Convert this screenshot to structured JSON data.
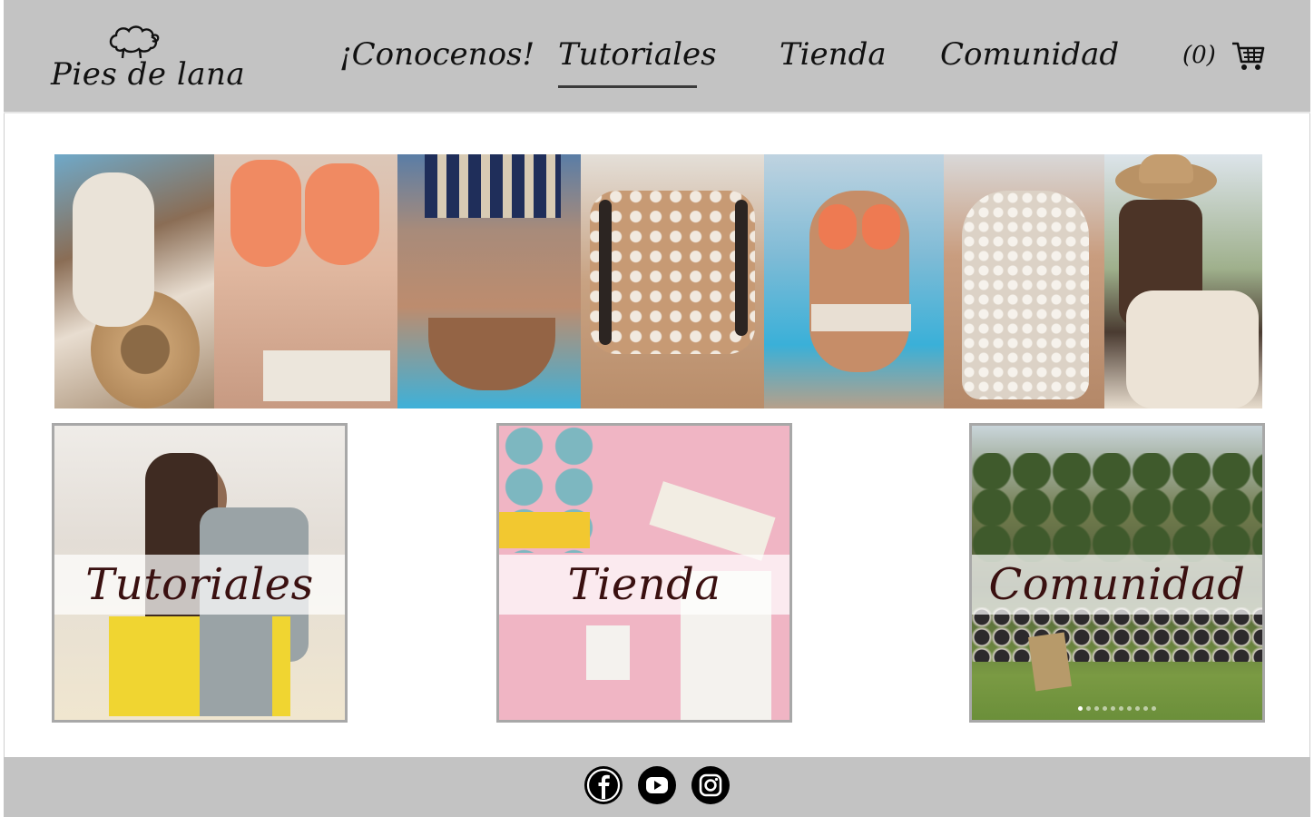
{
  "brand": {
    "name": "Pies de lana"
  },
  "nav": {
    "items": [
      {
        "label": "¡Conocenos!"
      },
      {
        "label": "Tutoriales"
      },
      {
        "label": "Tienda"
      },
      {
        "label": "Comunidad"
      }
    ],
    "active": "Tutoriales"
  },
  "cart": {
    "count": "(0)",
    "icon": "shopping-cart-icon"
  },
  "gallery": {
    "photos": [
      {
        "icon": "crochet-swimsuit-hat-photo"
      },
      {
        "icon": "coral-crochet-bikini-photo"
      },
      {
        "icon": "striped-crochet-bikini-photo"
      },
      {
        "icon": "crochet-halter-top-photo"
      },
      {
        "icon": "coral-bikini-pool-photo"
      },
      {
        "icon": "white-crochet-top-photo"
      },
      {
        "icon": "crochet-top-hat-photo"
      }
    ]
  },
  "cards": [
    {
      "title": "Tutoriales"
    },
    {
      "title": "Tienda"
    },
    {
      "title": "Comunidad"
    }
  ],
  "footer": {
    "social": [
      {
        "icon": "facebook-icon"
      },
      {
        "icon": "youtube-icon"
      },
      {
        "icon": "instagram-icon"
      }
    ]
  },
  "colors": {
    "header_bg": "#c3c3c3",
    "card_title": "#3a1010",
    "text": "#111111"
  }
}
